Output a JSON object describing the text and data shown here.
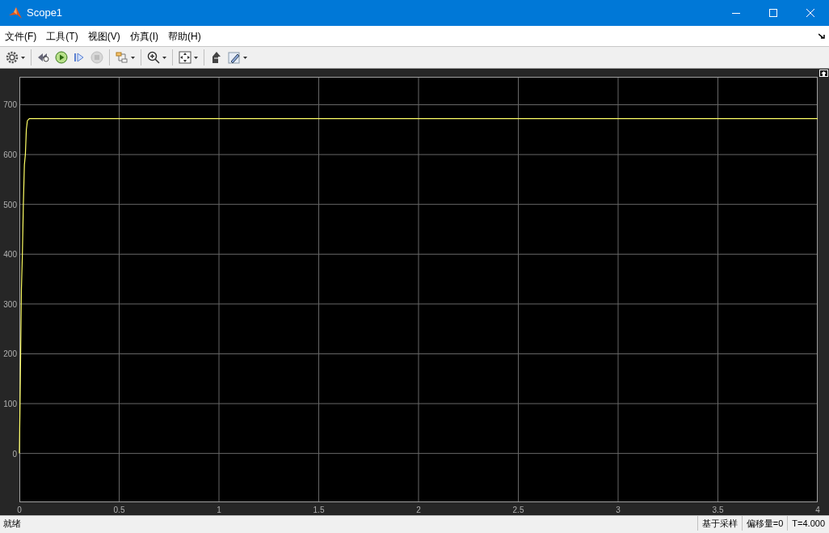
{
  "window": {
    "title": "Scope1"
  },
  "menu": [
    {
      "label": "文件(F)"
    },
    {
      "label": "工具(T)"
    },
    {
      "label": "视图(V)"
    },
    {
      "label": "仿真(I)"
    },
    {
      "label": "帮助(H)"
    }
  ],
  "toolbar": [
    {
      "kind": "settings",
      "dropdown": true,
      "disabled": false
    },
    {
      "kind": "separator"
    },
    {
      "kind": "rewind",
      "dropdown": false,
      "disabled": false
    },
    {
      "kind": "run",
      "dropdown": false,
      "disabled": false
    },
    {
      "kind": "step",
      "dropdown": false,
      "disabled": false
    },
    {
      "kind": "stop",
      "dropdown": false,
      "disabled": true
    },
    {
      "kind": "separator"
    },
    {
      "kind": "signals",
      "dropdown": true,
      "disabled": false
    },
    {
      "kind": "separator"
    },
    {
      "kind": "zoom",
      "dropdown": true,
      "disabled": false
    },
    {
      "kind": "separator"
    },
    {
      "kind": "fit",
      "dropdown": true,
      "disabled": false
    },
    {
      "kind": "separator"
    },
    {
      "kind": "highlight",
      "dropdown": false,
      "disabled": false
    },
    {
      "kind": "style",
      "dropdown": true,
      "disabled": false
    }
  ],
  "plot": {
    "chart_data": {
      "type": "line",
      "x": [
        0,
        0.005,
        0.01,
        0.012,
        0.015,
        0.02,
        0.025,
        0.03,
        0.035,
        0.04,
        0.05,
        4
      ],
      "series": [
        {
          "color": "#ffff66",
          "values": [
            0,
            150,
            330,
            360,
            400,
            500,
            580,
            600,
            650,
            668,
            672,
            672
          ]
        }
      ],
      "grid": true,
      "xlim": [
        0,
        4
      ],
      "ylim": [
        -98,
        756
      ],
      "xticks": [
        0,
        0.5,
        1,
        1.5,
        2,
        2.5,
        3,
        3.5,
        4
      ],
      "yticks": [
        0,
        100,
        200,
        300,
        400,
        500,
        600,
        700
      ]
    }
  },
  "status_bar": {
    "message": "就绪",
    "fields": [
      "基于采样",
      "偏移量=0",
      "T=4.000"
    ]
  }
}
